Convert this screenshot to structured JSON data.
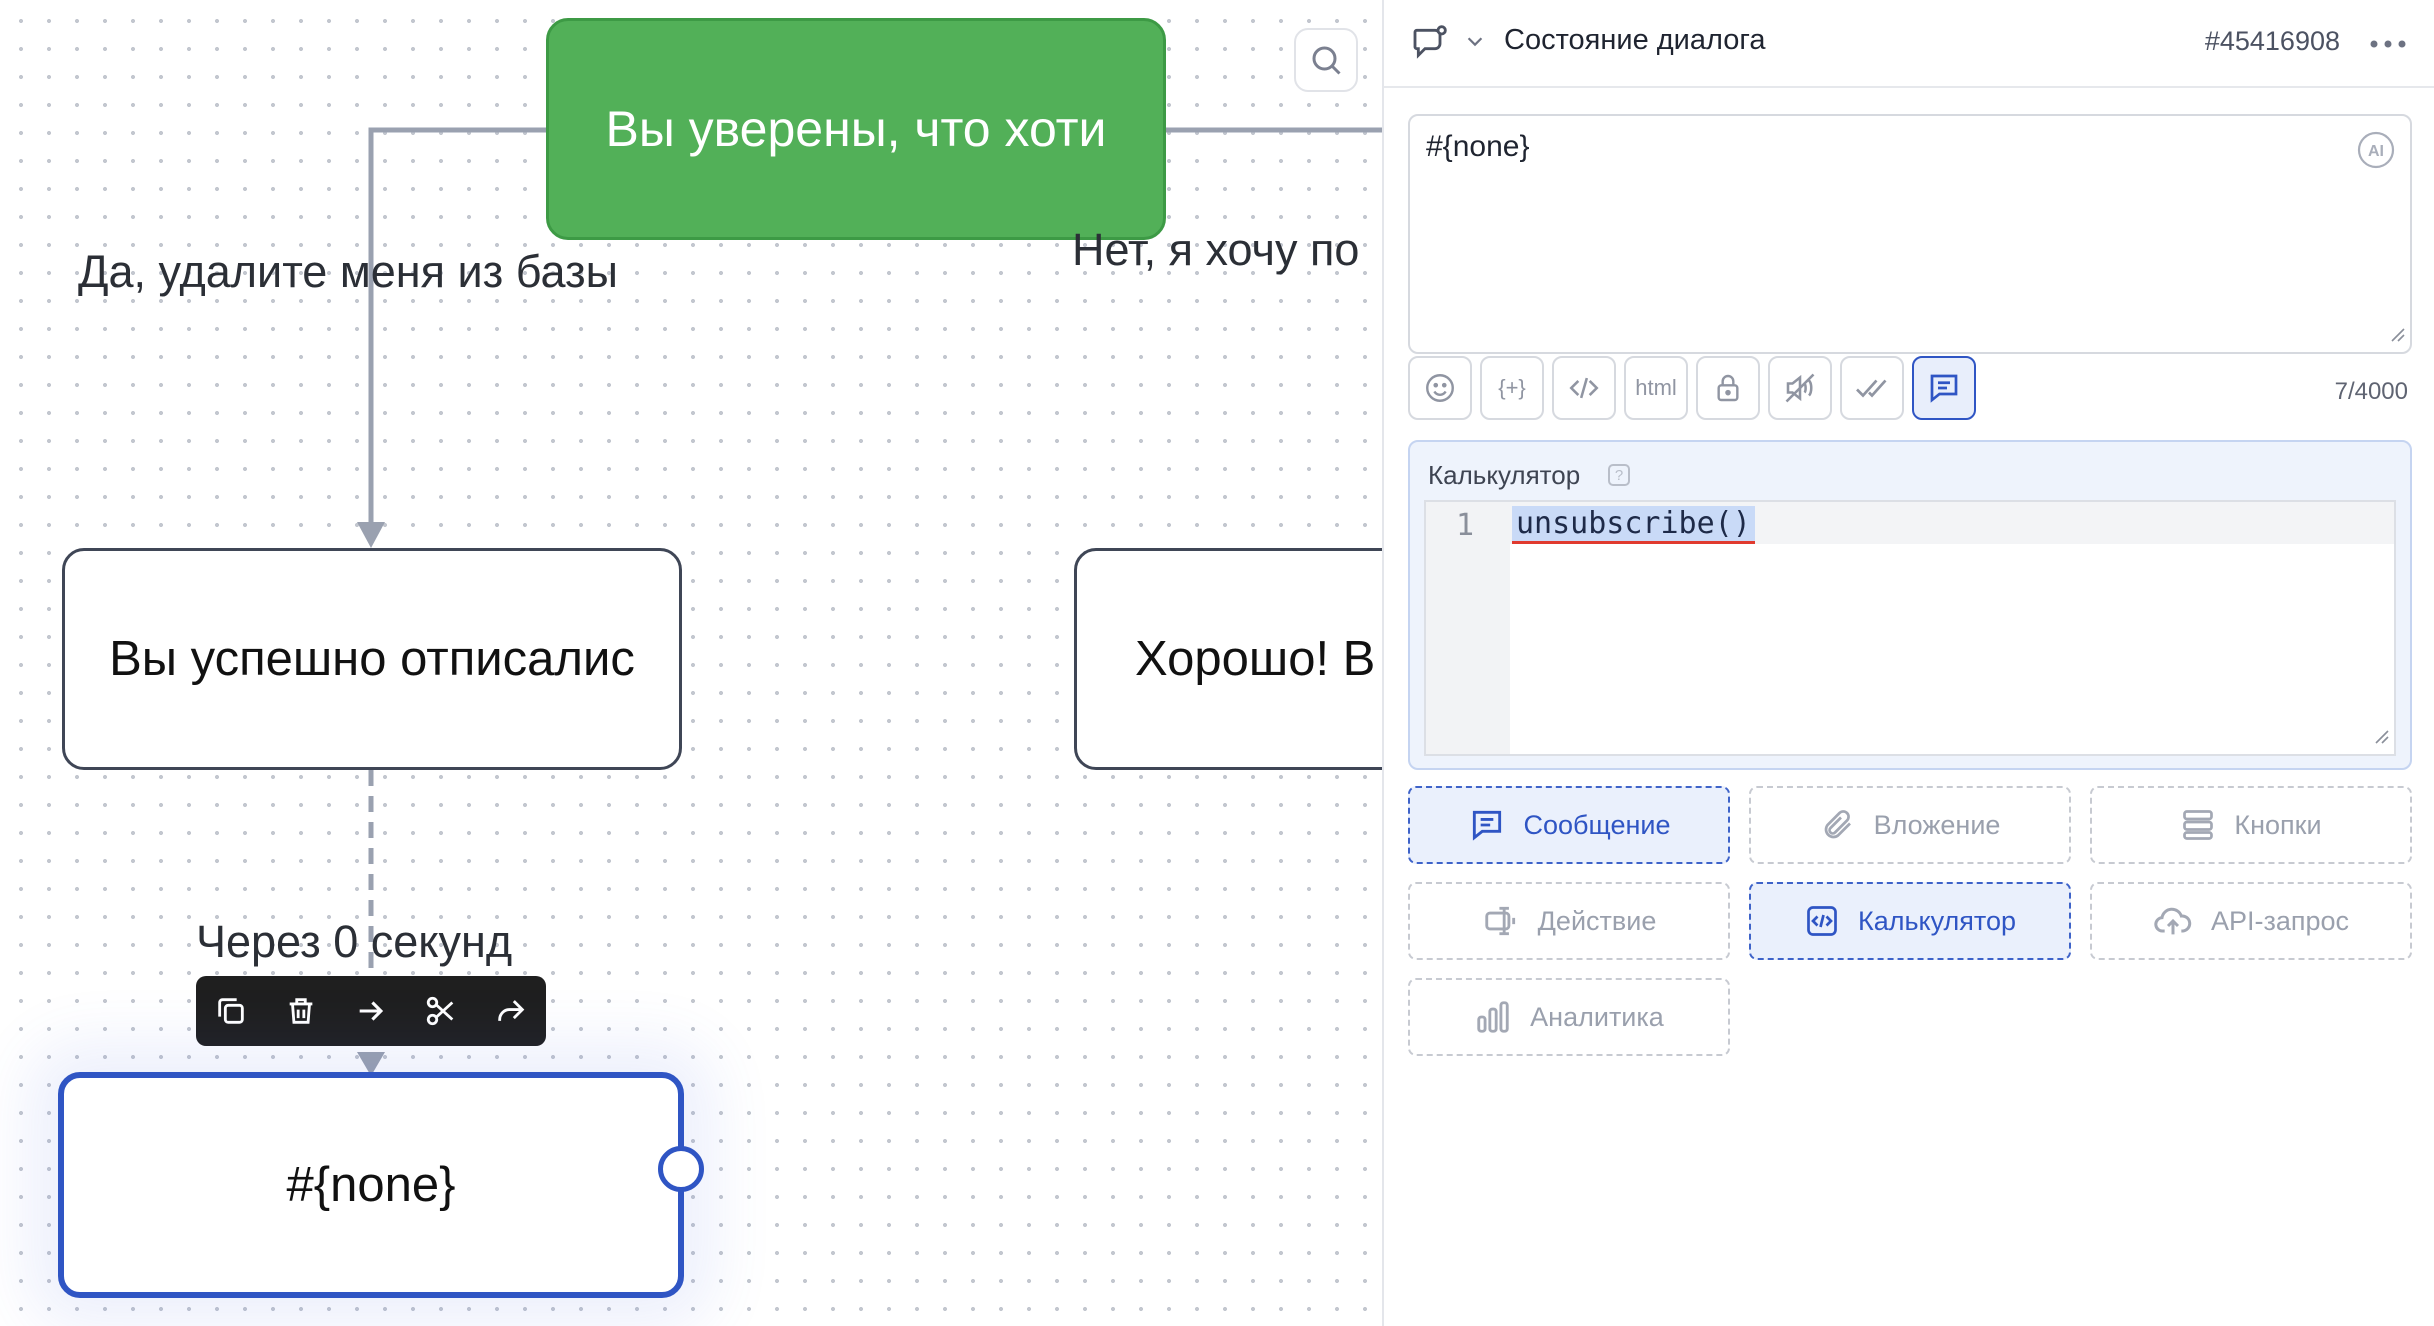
{
  "canvas": {
    "nodes": {
      "question": "Вы уверены, что хоти",
      "unsubscribed": "Вы успешно отписалис",
      "ok": "Хорошо!  В",
      "selected": "#{none}"
    },
    "edge_labels": {
      "yes": "Да, удалите меня из базы",
      "no": "Нет, я хочу по",
      "delay": "Через 0 секунд"
    },
    "toolbar_icons": [
      "copy-icon",
      "trash-icon",
      "arrow-right-icon",
      "scissors-icon",
      "share-icon"
    ],
    "colors": {
      "green_node": "#52b058",
      "selected_border": "#2f55c4",
      "wire": "#9aa1b0"
    }
  },
  "panel": {
    "title": "Состояние диалога",
    "id": "#45416908",
    "message": {
      "text": "#{none}",
      "char_count": "7/4000",
      "format_buttons": [
        {
          "name": "emoji-icon"
        },
        {
          "name": "variable-icon",
          "label": "{+}"
        },
        {
          "name": "code-icon"
        },
        {
          "name": "html-icon",
          "label": "html"
        },
        {
          "name": "lock-icon"
        },
        {
          "name": "mute-icon"
        },
        {
          "name": "read-check-icon"
        },
        {
          "name": "message-icon",
          "active": true
        }
      ]
    },
    "calculator": {
      "label": "Калькулятор",
      "help": "?",
      "line_number": "1",
      "code": "unsubscribe()"
    },
    "blocks": {
      "message": "Сообщение",
      "attachment": "Вложение",
      "buttons": "Кнопки",
      "action": "Действие",
      "calculator": "Калькулятор",
      "api": "API-запрос",
      "analytics": "Аналитика"
    },
    "accent": "#2f55c4"
  }
}
